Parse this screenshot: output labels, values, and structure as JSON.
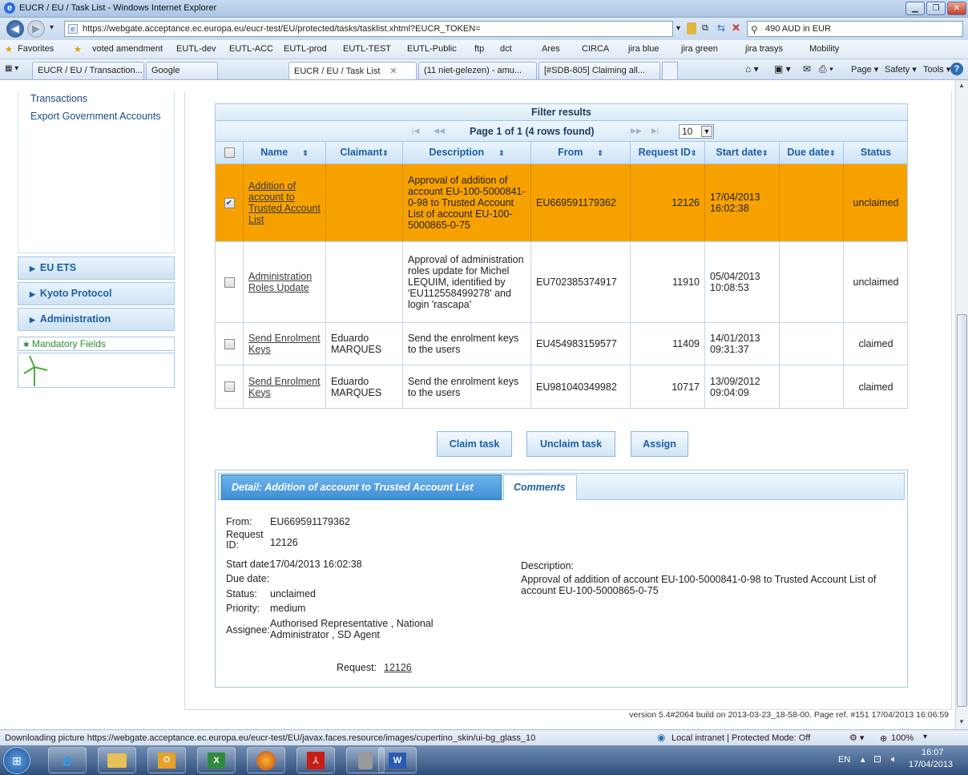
{
  "window": {
    "title": "EUCR / EU / Task List - Windows Internet Explorer",
    "url": "https://webgate.acceptance.ec.europa.eu/eucr-test/EU/protected/tasks/tasklist.xhtml?EUCR_TOKEN=",
    "search_text": "490 AUD in EUR"
  },
  "favorites": {
    "label": "Favorites",
    "items": [
      "voted amendment",
      "EUTL-dev",
      "EUTL-ACC",
      "EUTL-prod",
      "EUTL-TEST",
      "EUTL-Public",
      "ftp",
      "dct",
      "Ares",
      "CIRCA",
      "jira blue",
      "jira green",
      "jira trasys",
      "Mobility"
    ]
  },
  "tabs": {
    "items": [
      "EUCR / EU / Transaction...",
      "Google",
      "EUCR / EU / Task List",
      "(11 niet-gelezen) - amu...",
      "[#SDB-805] Claiming all..."
    ],
    "commands": [
      "Page ▾",
      "Safety ▾",
      "Tools ▾"
    ]
  },
  "sidebar": {
    "links": [
      "Transactions",
      "Export Government Accounts"
    ],
    "sections": [
      "EU ETS",
      "Kyoto Protocol",
      "Administration"
    ],
    "mandatory": "Mandatory Fields"
  },
  "table": {
    "title": "Filter results",
    "pager_text": "Page 1 of 1 (4 rows found)",
    "page_size": "10",
    "headers": [
      "Name",
      "Claimant",
      "Description",
      "From",
      "Request ID",
      "Start date",
      "Due date",
      "Status"
    ],
    "rows": [
      {
        "checked": true,
        "name": "Addition of account to Trusted Account List",
        "claimant": "",
        "description": "Approval of addition of account EU-100-5000841-0-98 to Trusted Account List of account EU-100-5000865-0-75",
        "from": "EU669591179362",
        "request_id": "12126",
        "start_date": "17/04/2013 16:02:38",
        "due_date": "",
        "status": "unclaimed"
      },
      {
        "checked": false,
        "name": "Administration Roles Update",
        "claimant": "",
        "description": "Approval of administration roles update for Michel LEQUIM, identified by 'EU112558499278' and login 'rascapa'",
        "from": "EU702385374917",
        "request_id": "11910",
        "start_date": "05/04/2013 10:08:53",
        "due_date": "",
        "status": "unclaimed"
      },
      {
        "checked": false,
        "name": "Send Enrolment Keys",
        "claimant": "Eduardo MARQUES",
        "description": "Send the enrolment keys to the users",
        "from": "EU454983159577",
        "request_id": "11409",
        "start_date": "14/01/2013 09:31:37",
        "due_date": "",
        "status": "claimed"
      },
      {
        "checked": false,
        "name": "Send Enrolment Keys",
        "claimant": "Eduardo MARQUES",
        "description": "Send the enrolment keys to the users",
        "from": "EU981040349982",
        "request_id": "10717",
        "start_date": "13/09/2012 09:04:09",
        "due_date": "",
        "status": "claimed"
      }
    ]
  },
  "actions": {
    "claim": "Claim task",
    "unclaim": "Unclaim task",
    "assign": "Assign"
  },
  "detail": {
    "tab_detail": "Detail: Addition of account to Trusted Account List",
    "tab_comments": "Comments",
    "labels": {
      "from": "From:",
      "request_id": "Request ID:",
      "start_date": "Start date:",
      "due_date": "Due date:",
      "status": "Status:",
      "priority": "Priority:",
      "assignee": "Assignee:",
      "description": "Description:",
      "request": "Request:"
    },
    "values": {
      "from": "EU669591179362",
      "request_id": "12126",
      "start_date": "17/04/2013 16:02:38",
      "due_date": "",
      "status": "unclaimed",
      "priority": "medium",
      "assignee": "Authorised Representative , National Administrator , SD Agent",
      "description": "Approval of addition of account EU-100-5000841-0-98 to Trusted Account List of account EU-100-5000865-0-75",
      "request": "12126"
    }
  },
  "footer": "version 5.4#2064 build on 2013-03-23_18-58-00. Page ref. #151 17/04/2013 16:06:59",
  "statusbar": {
    "text": "Downloading picture https://webgate.acceptance.ec.europa.eu/eucr-test/EU/javax.faces.resource/images/cupertino_skin/ui-bg_glass_10",
    "zone": "Local intranet | Protected Mode: Off",
    "zoom": "100%"
  },
  "taskbar": {
    "lang": "EN",
    "time": "16:07",
    "date": "17/04/2013"
  },
  "colors": {
    "selected_row": "#f7a100",
    "accent": "#1a5ea8"
  }
}
